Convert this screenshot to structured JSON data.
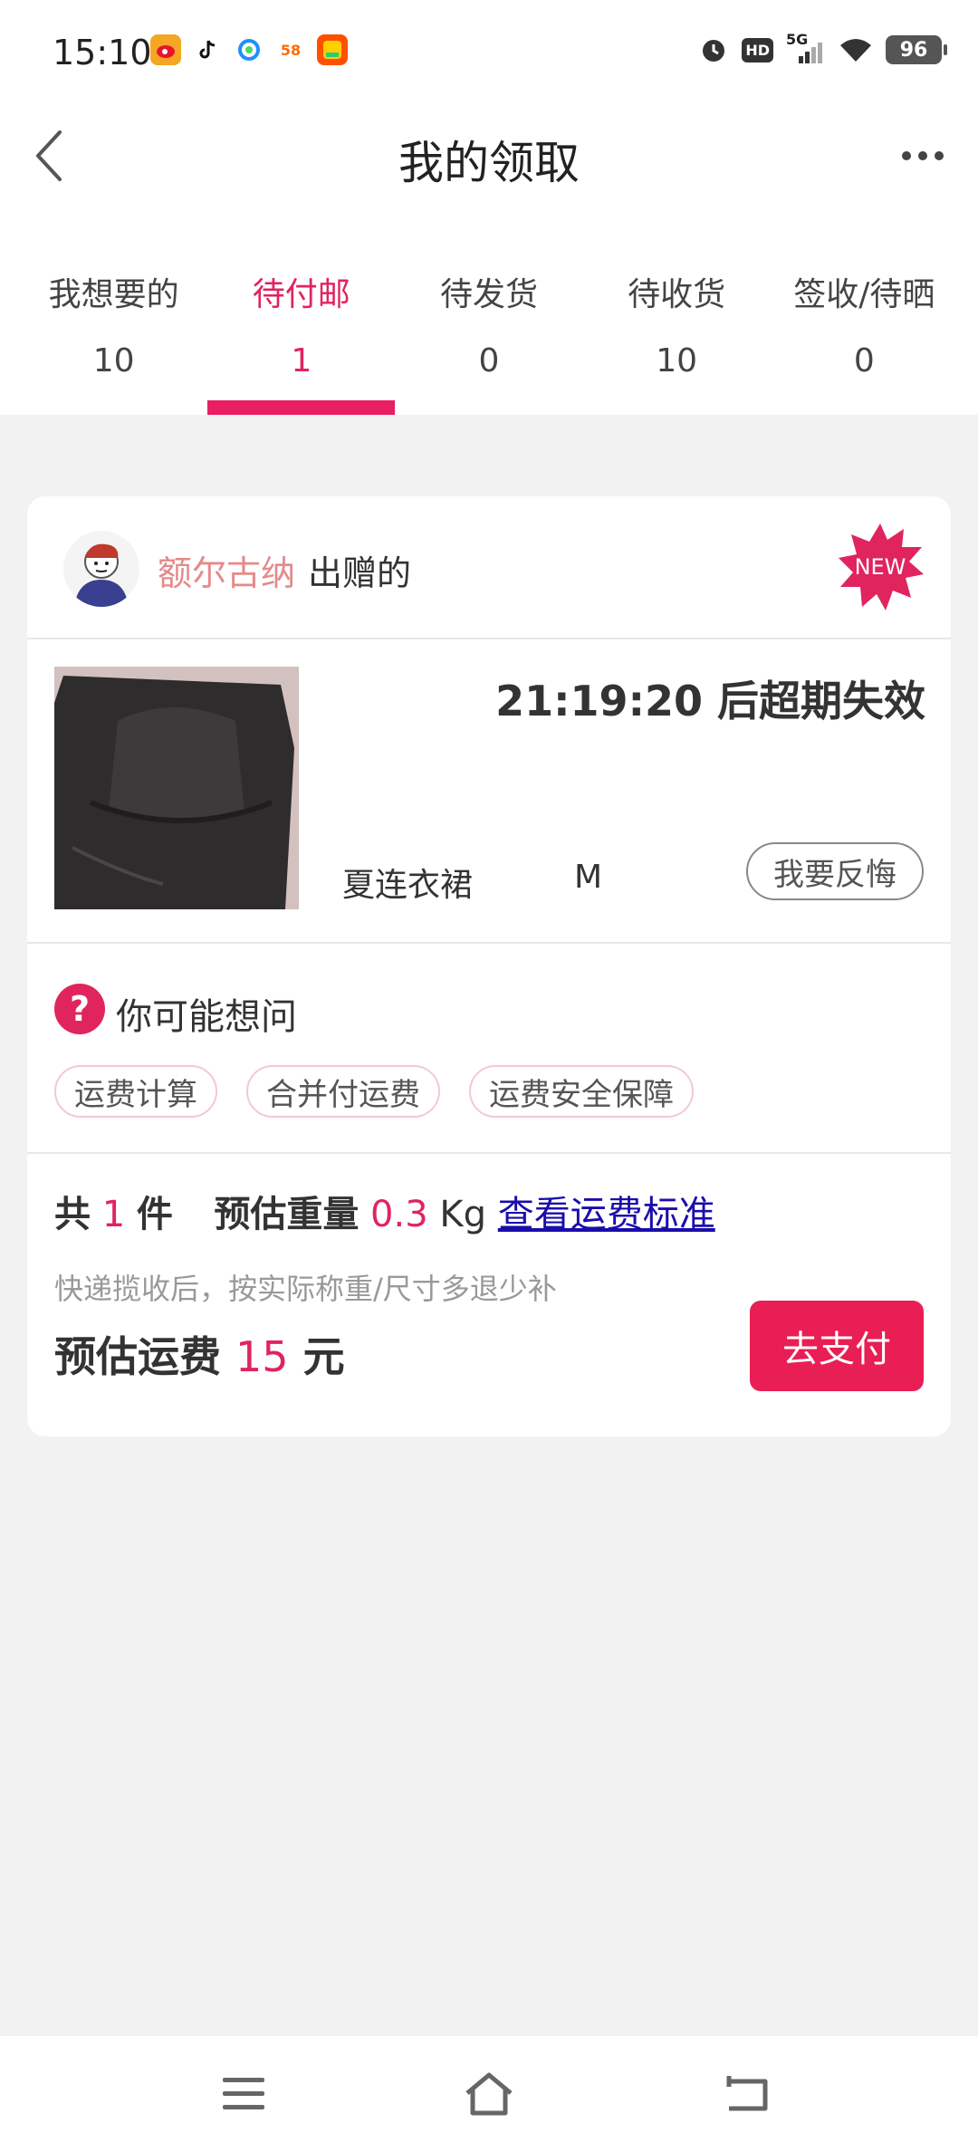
{
  "status_bar": {
    "time": "15:10",
    "app_icons": [
      "weibo-icon",
      "tiktok-icon",
      "qq-browser-icon",
      "58-app-icon",
      "taobao-app-icon"
    ],
    "icons": [
      "alarm-icon",
      "hd-icon",
      "5g-signal-icon",
      "wifi-icon"
    ],
    "hd_label": "HD",
    "network_label": "5G",
    "battery": "96"
  },
  "header": {
    "title": "我的领取"
  },
  "tabs": [
    {
      "label": "我想要的",
      "count": "10",
      "active": false
    },
    {
      "label": "待付邮",
      "count": "1",
      "active": true
    },
    {
      "label": "待发货",
      "count": "0",
      "active": false
    },
    {
      "label": "待收货",
      "count": "10",
      "active": false
    },
    {
      "label": "签收/待晒",
      "count": "0",
      "active": false
    }
  ],
  "card": {
    "giver_name": "额尔古纳",
    "giver_suffix": "出赠的",
    "new_badge": "NEW",
    "expire_text": "21:19:20 后超期失效",
    "item_name": "夏连衣裙",
    "item_size": "M",
    "regret_button": "我要反悔",
    "faq_title": "你可能想问",
    "faq_icon_glyph": "?",
    "chips": [
      "运费计算",
      "合并付运费",
      "运费安全保障"
    ],
    "summary": {
      "total_prefix": "共",
      "total_count": "1",
      "total_suffix": "件",
      "weight_label": "预估重量",
      "weight_value": "0.3",
      "weight_unit": "Kg",
      "shipping_link": "查看运费标准",
      "note": "快递揽收后，按实际称重/尺寸多退少补",
      "fee_label": "预估运费",
      "fee_value": "15",
      "fee_unit": "元",
      "pay_button": "去支付"
    }
  },
  "bottom_nav": [
    "menu-icon",
    "home-icon",
    "back-icon"
  ],
  "colors": {
    "accent": "#e91e63",
    "giver_name": "#e58a8a",
    "link": "#1a0dab",
    "background": "#f2f2f2"
  }
}
